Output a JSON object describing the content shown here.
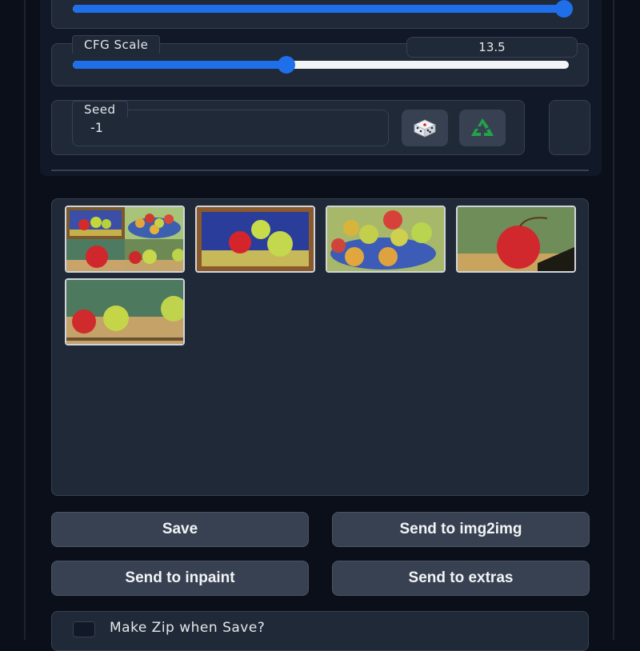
{
  "sliders": {
    "top_slider": {
      "value_fraction": 0.99
    },
    "cfg_scale": {
      "label": "CFG Scale",
      "value": "13.5",
      "value_fraction": 0.43
    }
  },
  "seed": {
    "label": "Seed",
    "value": "-1",
    "random_icon": "dice-icon",
    "reuse_icon": "recycle-icon"
  },
  "gallery": {
    "images": [
      {
        "description": "grid",
        "icon": "apple-painting-grid"
      },
      {
        "description": "framed",
        "icon": "apple-painting-framed"
      },
      {
        "description": "bowl",
        "icon": "apple-painting-bowl"
      },
      {
        "description": "single",
        "icon": "apple-painting-single"
      },
      {
        "description": "three",
        "icon": "apple-painting-three"
      }
    ]
  },
  "buttons": {
    "save": "Save",
    "send_img2img": "Send to img2img",
    "send_inpaint": "Send to inpaint",
    "send_extras": "Send to extras"
  },
  "zip": {
    "label": "Make Zip when Save?",
    "checked": false
  },
  "colors": {
    "accent": "#1f6feb",
    "background": "#0b0f19",
    "panel": "#1f2937",
    "button": "#374151"
  }
}
